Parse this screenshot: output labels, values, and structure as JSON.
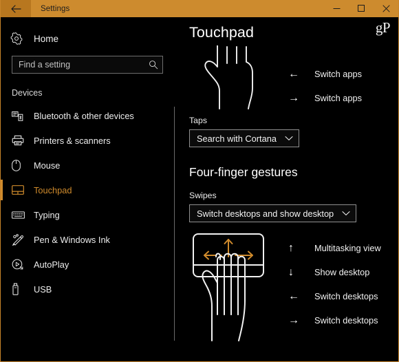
{
  "titlebar": {
    "back_icon": "arrow-left-icon",
    "title": "Settings",
    "minimize_label": "─",
    "maximize_label": "☐",
    "close_label": "✕",
    "bg_color": "#cd8b2e",
    "back_bg_color": "#b8771f"
  },
  "watermark": {
    "text": "gP"
  },
  "sidebar": {
    "home": {
      "label": "Home",
      "icon": "gear-icon"
    },
    "search": {
      "placeholder": "Find a setting",
      "value": "",
      "icon": "search-icon"
    },
    "group_title": "Devices",
    "accent_color": "#d08b2c",
    "items": [
      {
        "label": "Bluetooth & other devices",
        "icon": "bluetooth-devices-icon",
        "active": false
      },
      {
        "label": "Printers & scanners",
        "icon": "printer-icon",
        "active": false
      },
      {
        "label": "Mouse",
        "icon": "mouse-icon",
        "active": false
      },
      {
        "label": "Touchpad",
        "icon": "touchpad-icon",
        "active": true
      },
      {
        "label": "Typing",
        "icon": "keyboard-icon",
        "active": false
      },
      {
        "label": "Pen & Windows Ink",
        "icon": "pen-icon",
        "active": false
      },
      {
        "label": "AutoPlay",
        "icon": "autoplay-icon",
        "active": false
      },
      {
        "label": "USB",
        "icon": "usb-icon",
        "active": false
      }
    ]
  },
  "main": {
    "page_title": "Touchpad",
    "three_finger": {
      "illustration": "three-finger-hand-illustration",
      "gestures": [
        {
          "arrow": "arrow-left-icon",
          "glyph": "←",
          "label": "Switch apps"
        },
        {
          "arrow": "arrow-right-icon",
          "glyph": "→",
          "label": "Switch apps"
        }
      ],
      "taps": {
        "label": "Taps",
        "value": "Search with Cortana",
        "chevron": "chevron-down-icon"
      }
    },
    "four_finger": {
      "heading": "Four-finger gestures",
      "swipes": {
        "label": "Swipes",
        "value": "Switch desktops and show desktop",
        "chevron": "chevron-down-icon"
      },
      "illustration": "four-finger-touchpad-illustration",
      "illustration_arrow_color": "#d08b2c",
      "gestures": [
        {
          "arrow": "arrow-up-icon",
          "glyph": "↑",
          "label": "Multitasking view"
        },
        {
          "arrow": "arrow-down-icon",
          "glyph": "↓",
          "label": "Show desktop"
        },
        {
          "arrow": "arrow-left-icon",
          "glyph": "←",
          "label": "Switch desktops"
        },
        {
          "arrow": "arrow-right-icon",
          "glyph": "→",
          "label": "Switch desktops"
        }
      ]
    }
  }
}
